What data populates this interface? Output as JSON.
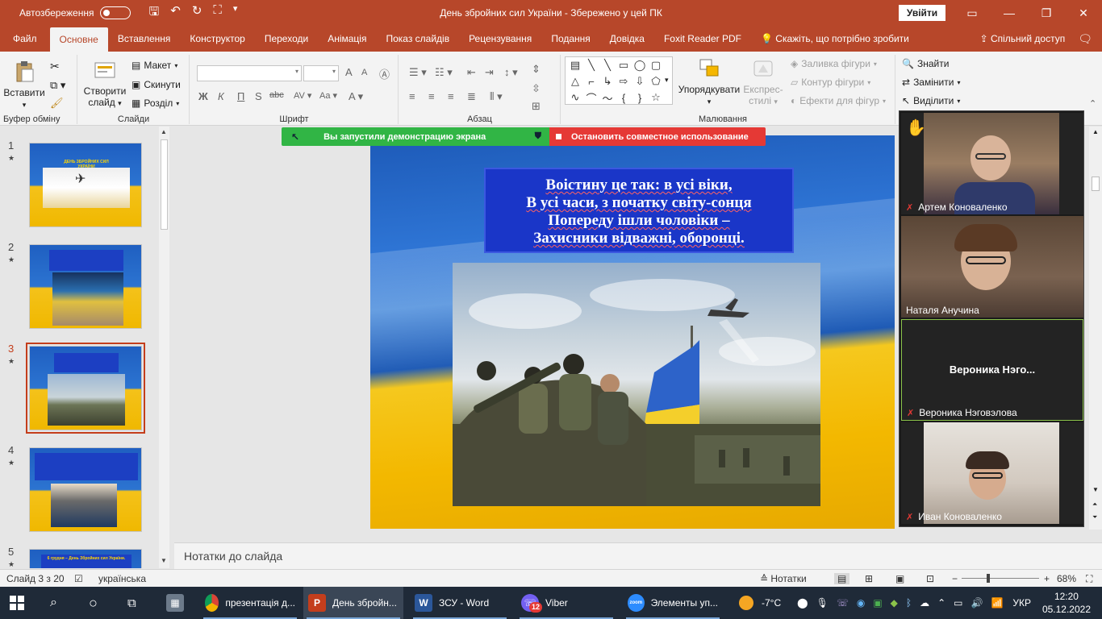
{
  "titlebar": {
    "autosave_label": "Автозбереження",
    "doc_title": "День збройних сил України  -  Збережено у цей ПК",
    "signin_label": "Увійти"
  },
  "tabs": [
    "Файл",
    "Основне",
    "Вставлення",
    "Конструктор",
    "Переходи",
    "Анімація",
    "Показ слайдів",
    "Рецензування",
    "Подання",
    "Довідка",
    "Foxit Reader PDF"
  ],
  "tell_me": "Скажіть, що потрібно зробити",
  "share": "Спільний доступ",
  "ribbon": {
    "clipboard": {
      "paste": "Вставити",
      "label": "Буфер обміну"
    },
    "slides": {
      "new_slide_1": "Створити",
      "new_slide_2": "слайд",
      "layout": "Макет",
      "reset": "Скинути",
      "section": "Розділ",
      "label": "Слайди"
    },
    "font": {
      "label": "Шрифт",
      "bold": "Ж",
      "italic": "К",
      "underline": "П",
      "strike": "abc",
      "font_a_big": "A",
      "font_a_small": "A"
    },
    "paragraph": {
      "label": "Абзац"
    },
    "drawing": {
      "arrange": "Упорядкувати",
      "quick_styles_1": "Експрес-",
      "quick_styles_2": "стилі",
      "fill": "Заливка фігури",
      "outline": "Контур фігури",
      "effects": "Ефекти для фігур",
      "label": "Малювання"
    },
    "editing": {
      "find": "Знайти",
      "replace": "Замінити",
      "select": "Виділити"
    }
  },
  "share_banner": {
    "running": "Вы запустили демонстрацию экрана",
    "stop": "Остановить совместное использование"
  },
  "thumbnails": [
    {
      "num": "1",
      "title": "ДЕНЬ ЗБРОЙНИХ СИЛ УКРАЇНИ"
    },
    {
      "num": "2",
      "title": ""
    },
    {
      "num": "3",
      "title": ""
    },
    {
      "num": "4",
      "title": ""
    },
    {
      "num": "5",
      "title": "6 грудня – День Збройних сил України."
    }
  ],
  "slide": {
    "lines": [
      "Воістину це так: в усі віки,",
      "В усі часи, з початку світу-сонця",
      "Попереду ішли чоловіки –",
      "Захисники відважні, оборонці."
    ]
  },
  "participants": [
    {
      "name": "Артем Коноваленко"
    },
    {
      "name": "Наталя Анучина"
    },
    {
      "name": "Вероника Нэговэлова",
      "short": "Вероника  Нэго..."
    },
    {
      "name": "Иван Коноваленко"
    }
  ],
  "notes_placeholder": "Нотатки до слайда",
  "status": {
    "slide_info": "Слайд 3 з 20",
    "language": "українська",
    "notes_btn": "Нотатки",
    "zoom": "68%",
    "zoom_level": 0.68
  },
  "taskbar": {
    "apps": [
      {
        "label": "презентація д..."
      },
      {
        "label": "День збройн..."
      },
      {
        "label": "ЗСУ - Word"
      },
      {
        "label": "Viber",
        "badge": "12"
      },
      {
        "label": "Элементы уп..."
      }
    ],
    "weather": "-7°C",
    "lang": "УКР",
    "time": "12:20",
    "date": "05.12.2022"
  },
  "colors": {
    "accent": "#b7472a",
    "taskbar": "#1f2a38",
    "share_green": "#31b545",
    "share_red": "#e53935"
  }
}
